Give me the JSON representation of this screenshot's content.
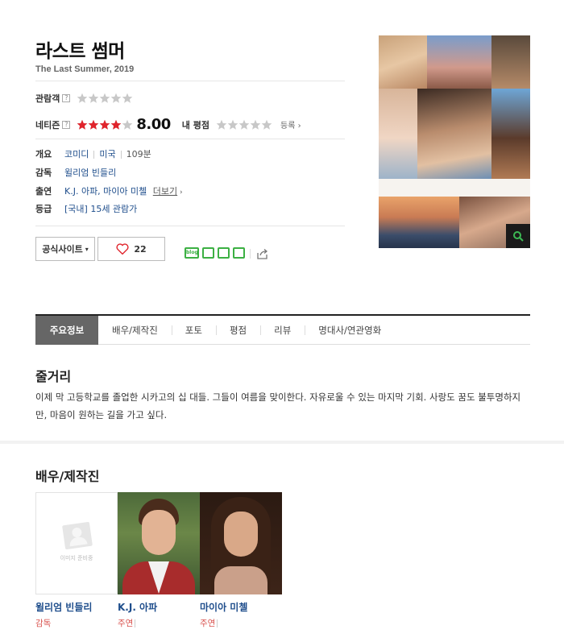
{
  "movie": {
    "title": "라스트 썸머",
    "subtitle": "The Last Summer, 2019"
  },
  "ratings": {
    "audience_label": "관람객",
    "audience_rating": 0,
    "netizen_label": "네티즌",
    "netizen_rating": 8.0,
    "netizen_score": "8.00",
    "my_label": "내 평점",
    "my_rating": 0,
    "register_label": "등록",
    "star_color": "#e0242c"
  },
  "info": {
    "overview_label": "개요",
    "genre": "코미디",
    "country": "미국",
    "runtime": "109분",
    "director_label": "감독",
    "director": "윌리엄 빈들리",
    "cast_label": "출연",
    "cast": "K.J. 아파, 마이아 미첼",
    "more_label": "더보기",
    "grade_label": "등급",
    "grade": "[국내] 15세 관람가"
  },
  "actions": {
    "official_site_label": "공식사이트",
    "like_count": "22",
    "sns_icons": [
      "blog-icon",
      "kakaotalk-icon",
      "line-icon",
      "facebook-icon"
    ],
    "share_icon": "share-icon"
  },
  "tabs": [
    {
      "label": "주요정보",
      "active": true
    },
    {
      "label": "배우/제작진"
    },
    {
      "label": "포토"
    },
    {
      "label": "평점"
    },
    {
      "label": "리뷰"
    },
    {
      "label": "명대사/연관영화"
    }
  ],
  "synopsis": {
    "heading": "줄거리",
    "text": "이제 막 고등학교를 졸업한 시카고의 십 대들. 그들이 여름을 맞이한다. 자유로울 수 있는 마지막 기회. 사랑도 꿈도 불투명하지만, 마음이 원하는 길을 가고 싶다."
  },
  "cast_section": {
    "heading": "배우/제작진",
    "placeholder_text": "이미지 준비중",
    "people": [
      {
        "name": "윌리엄 빈들리",
        "role": "감독"
      },
      {
        "name": "K.J. 아파",
        "role": "주연"
      },
      {
        "name": "마이아 미첼",
        "role": "주연"
      }
    ]
  },
  "poster": {
    "title_text": "라스트 썸머"
  }
}
